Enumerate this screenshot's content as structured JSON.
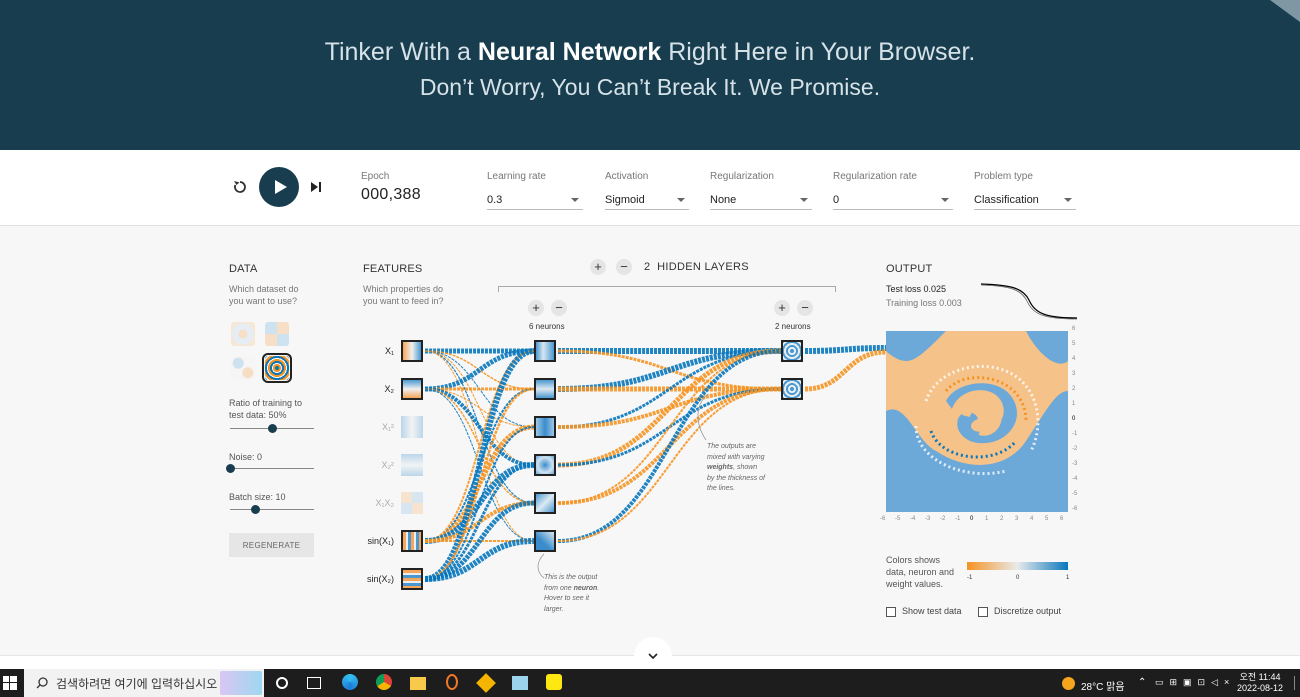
{
  "hero": {
    "line1_pre": "Tinker With a ",
    "line1_bold": "Neural Network",
    "line1_post": " Right Here in Your Browser.",
    "line2": "Don’t Worry, You Can’t Break It. We Promise."
  },
  "controls": {
    "epoch_label": "Epoch",
    "epoch_value": "000,388",
    "learning_rate": {
      "label": "Learning rate",
      "value": "0.3"
    },
    "activation": {
      "label": "Activation",
      "value": "Sigmoid"
    },
    "regularization": {
      "label": "Regularization",
      "value": "None"
    },
    "regularization_rate": {
      "label": "Regularization rate",
      "value": "0"
    },
    "problem_type": {
      "label": "Problem type",
      "value": "Classification"
    }
  },
  "data_panel": {
    "title": "DATA",
    "subtitle_1": "Which dataset do",
    "subtitle_2": "you want to use?",
    "ratio_label_1": "Ratio of training to",
    "ratio_label_2": "test data:  50%",
    "ratio_value": 0.5,
    "noise_label": "Noise:  0",
    "noise_value": 0,
    "batch_label": "Batch size:  10",
    "batch_value": 0.3,
    "regenerate": "REGENERATE"
  },
  "features_panel": {
    "title": "FEATURES",
    "subtitle_1": "Which properties do",
    "subtitle_2": "you want to feed in?",
    "features": [
      "X₁",
      "X₂",
      "X₁²",
      "X₂²",
      "X₁X₂",
      "sin(X₁)",
      "sin(X₂)"
    ]
  },
  "hidden": {
    "count": "2",
    "label": "HIDDEN LAYERS",
    "layer1_label": "6 neurons",
    "layer2_label": "2 neurons",
    "note_weights_1": "The outputs are",
    "note_weights_2": "mixed with varying",
    "note_weights_3": "weights",
    "note_weights_3b": ", shown",
    "note_weights_4": "by the thickness of",
    "note_weights_5": "the lines.",
    "note_neuron_1": "This is the output",
    "note_neuron_2": "from one ",
    "note_neuron_2b": "neuron",
    "note_neuron_2c": ".",
    "note_neuron_3": "Hover to see it",
    "note_neuron_4": "larger."
  },
  "output": {
    "title": "OUTPUT",
    "test_loss": "Test loss 0.025",
    "training_loss": "Training loss 0.003",
    "axis_ticks": [
      "-6",
      "-5",
      "-4",
      "-3",
      "-2",
      "-1",
      "0",
      "1",
      "2",
      "3",
      "4",
      "5",
      "6"
    ],
    "y_ticks": [
      "6",
      "5",
      "4",
      "3",
      "2",
      "1",
      "0",
      "-1",
      "-2",
      "-3",
      "-4",
      "-5",
      "-6"
    ],
    "legend_1": "Colors shows",
    "legend_2": "data, neuron and",
    "legend_3": "weight values.",
    "legend_min": "-1",
    "legend_mid": "0",
    "legend_max": "1",
    "show_test": "Show test data",
    "discretize": "Discretize output"
  },
  "colors": {
    "orange": "#f59322",
    "blue": "#0877bd",
    "navy": "#183d4e"
  },
  "taskbar": {
    "search_placeholder": "검색하려면 여기에 입력하십시오",
    "weather": "28°C  맑음",
    "time": "오전 11:44",
    "date": "2022-08-12"
  }
}
